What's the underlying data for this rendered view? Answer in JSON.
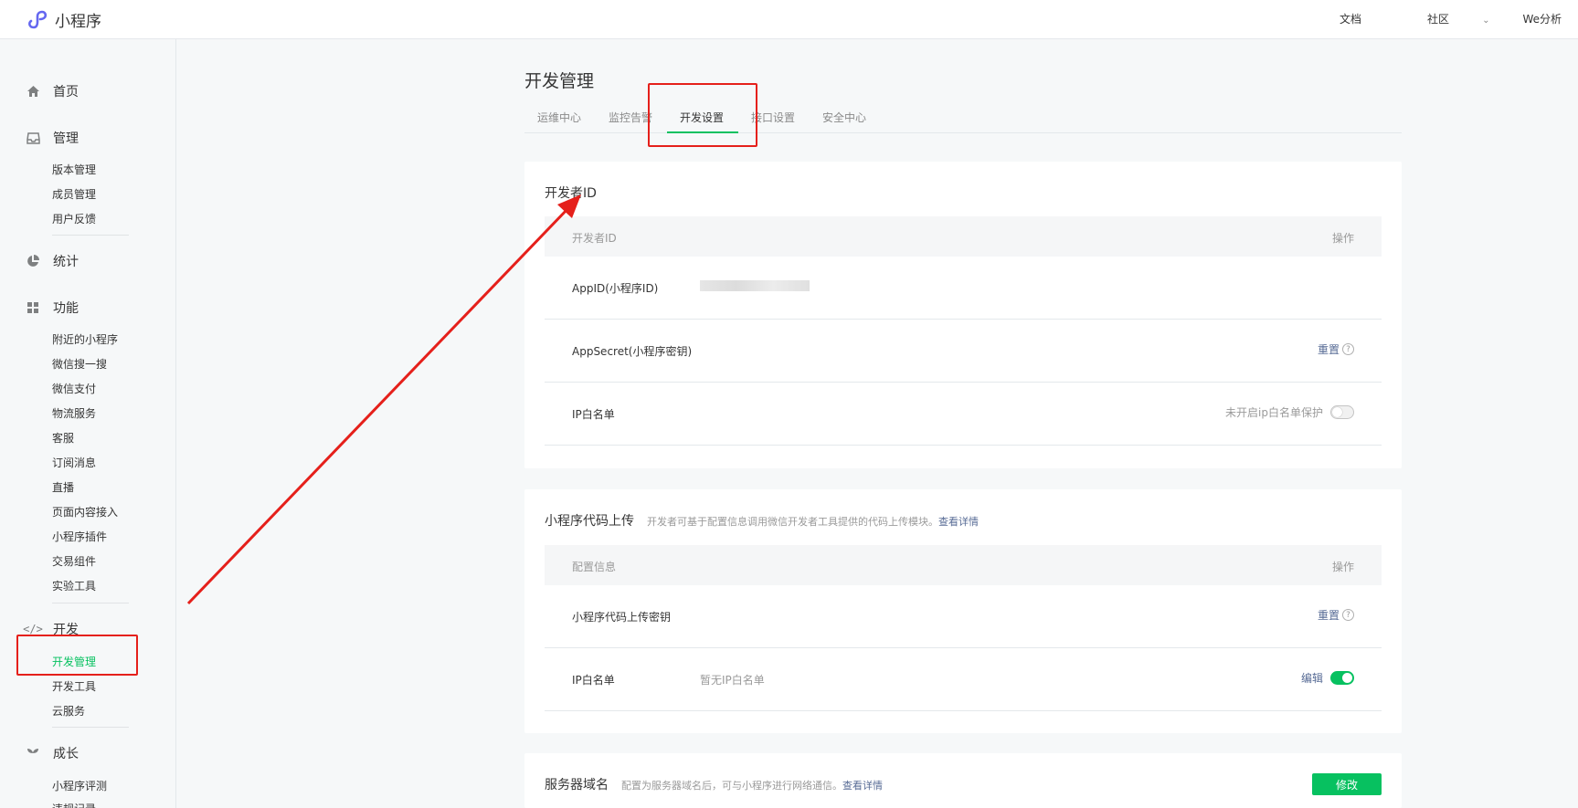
{
  "app": {
    "title": "小程序"
  },
  "topnav": {
    "docs": "文档",
    "community": "社区",
    "analytics": "We分析"
  },
  "sidebar": {
    "home": "首页",
    "manage": {
      "label": "管理",
      "items": [
        "版本管理",
        "成员管理",
        "用户反馈"
      ]
    },
    "stats": "统计",
    "features": {
      "label": "功能",
      "items": [
        "附近的小程序",
        "微信搜一搜",
        "微信支付",
        "物流服务",
        "客服",
        "订阅消息",
        "直播",
        "页面内容接入",
        "小程序插件",
        "交易组件",
        "实验工具"
      ]
    },
    "dev": {
      "label": "开发",
      "items": [
        "开发管理",
        "开发工具",
        "云服务"
      ]
    },
    "growth": {
      "label": "成长",
      "items": [
        "小程序评测",
        "违规记录"
      ]
    }
  },
  "main": {
    "title": "开发管理",
    "tabs": [
      "运维中心",
      "监控告警",
      "开发设置",
      "接口设置",
      "安全中心"
    ],
    "developer_id": {
      "title": "开发者ID",
      "col_left": "开发者ID",
      "col_right": "操作",
      "appid_label": "AppID(小程序ID)",
      "secret_label": "AppSecret(小程序密钥)",
      "reset": "重置",
      "ip_label": "IP白名单",
      "ip_status": "未开启ip白名单保护"
    },
    "upload": {
      "title": "小程序代码上传",
      "desc": "开发者可基于配置信息调用微信开发者工具提供的代码上传模块。",
      "detail": "查看详情",
      "col_left": "配置信息",
      "col_right": "操作",
      "key_label": "小程序代码上传密钥",
      "reset": "重置",
      "ip_label": "IP白名单",
      "ip_value": "暂无IP白名单",
      "edit": "编辑"
    },
    "server": {
      "title": "服务器域名",
      "desc": "配置为服务器域名后，可与小程序进行网络通信。",
      "detail": "查看详情",
      "modify": "修改"
    }
  },
  "colors": {
    "accent": "#07c160",
    "link": "#576b95",
    "annotation": "#e5201b"
  }
}
